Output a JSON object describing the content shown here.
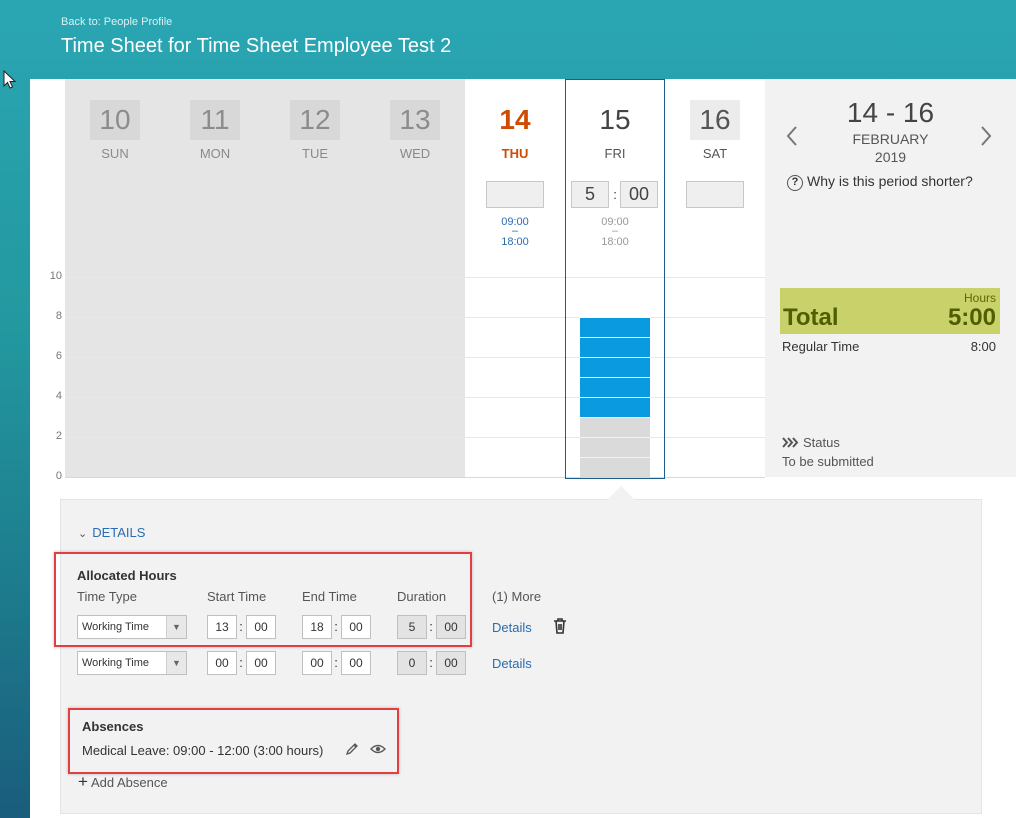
{
  "header": {
    "back_link": "Back to: People Profile",
    "title": "Time Sheet for Time Sheet Employee Test 2"
  },
  "week": {
    "days": [
      {
        "num": "10",
        "name": "SUN"
      },
      {
        "num": "11",
        "name": "MON"
      },
      {
        "num": "12",
        "name": "TUE"
      },
      {
        "num": "13",
        "name": "WED"
      },
      {
        "num": "14",
        "name": "THU"
      },
      {
        "num": "15",
        "name": "FRI"
      },
      {
        "num": "16",
        "name": "SAT"
      }
    ],
    "thu_time": {
      "start": "09:00",
      "dash": "–",
      "end": "18:00"
    },
    "fri_time": {
      "start": "09:00",
      "dash": "–",
      "end": "18:00"
    },
    "fri_hours": {
      "hh": "5",
      "sep": ":",
      "mm": "00"
    }
  },
  "chart_data": {
    "type": "bar",
    "categories": [
      "FRI"
    ],
    "y_ticks": [
      "0",
      "2",
      "4",
      "6",
      "8",
      "10"
    ],
    "ylim": [
      0,
      10
    ],
    "segments": [
      {
        "from": 0,
        "to": 3,
        "color": "#dadada"
      },
      {
        "from": 3,
        "to": 8,
        "color": "#0a9ae0"
      }
    ],
    "segment_unit": 1
  },
  "summary": {
    "range": "14 - 16",
    "month": "FEBRUARY",
    "year": "2019",
    "prev_icon": "chevron-left-icon",
    "next_icon": "chevron-right-icon",
    "why_link": "Why is this period shorter?",
    "hours_label": "Hours",
    "total_label": "Total",
    "total_value": "5:00",
    "regular_label": "Regular Time",
    "regular_value": "8:00",
    "status_label": "Status",
    "status_value": "To be submitted"
  },
  "details": {
    "toggle_label": "DETAILS",
    "allocated_title": "Allocated Hours",
    "headers": {
      "time_type": "Time Type",
      "start": "Start Time",
      "end": "End Time",
      "duration": "Duration"
    },
    "more_label": "(1) More",
    "rows": [
      {
        "type": "Working Time",
        "start_h": "13",
        "start_m": "00",
        "end_h": "18",
        "end_m": "00",
        "dur_h": "5",
        "dur_m": "00",
        "link": "Details"
      },
      {
        "type": "Working Time",
        "start_h": "00",
        "start_m": "00",
        "end_h": "00",
        "end_m": "00",
        "dur_h": "0",
        "dur_m": "00",
        "link": "Details"
      }
    ],
    "absences_title": "Absences",
    "absence_entry": "Medical Leave: 09:00 - 12:00 (3:00 hours)",
    "add_absence": "Add Absence"
  },
  "colors": {
    "accent": "#2a6cb0",
    "today": "#d04a02",
    "bar_blue": "#0a9ae0",
    "total_bg": "#c8d16a",
    "highlight": "#e04040"
  }
}
